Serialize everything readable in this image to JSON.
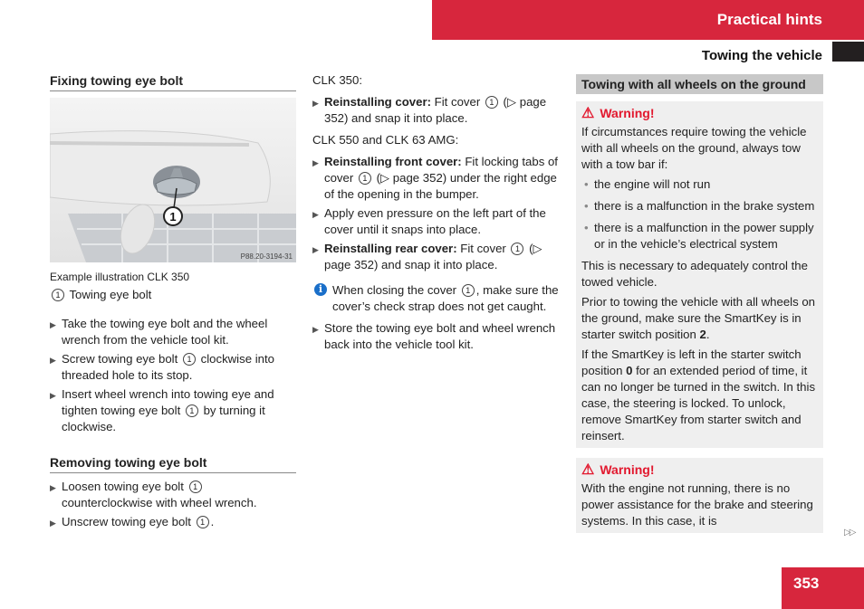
{
  "header": {
    "chapter": "Practical hints",
    "section": "Towing the vehicle",
    "accent_color": "#d7263d"
  },
  "col1": {
    "heading": "Fixing towing eye bolt",
    "figure": {
      "callout": "1",
      "code": "P88.20-3194-31",
      "caption": "Example illustration CLK 350"
    },
    "legend": {
      "num": "1",
      "label": "Towing eye bolt"
    },
    "steps": [
      {
        "pre": "Take the towing eye bolt and the wheel wrench from the vehicle tool kit.",
        "num": "",
        "post": ""
      },
      {
        "pre": "Screw towing eye bolt ",
        "num": "1",
        "post": " clockwise into threaded hole to its stop."
      },
      {
        "pre": "Insert wheel wrench into towing eye and tighten towing eye bolt ",
        "num": "1",
        "post": " by turning it clockwise."
      }
    ],
    "heading2": "Removing towing eye bolt",
    "steps2": [
      {
        "pre": "Loosen towing eye bolt ",
        "num": "1",
        "post": " counterclockwise with wheel wrench."
      },
      {
        "pre": "Unscrew towing eye bolt ",
        "num": "1",
        "post": "."
      }
    ]
  },
  "col2": {
    "model1": "CLK 350:",
    "step1": {
      "bold": "Reinstalling cover:",
      "pre": " Fit cover ",
      "num": "1",
      "post": " (▷ page 352) and snap it into place."
    },
    "model2": "CLK 550 and CLK 63 AMG:",
    "step2": {
      "bold": "Reinstalling front cover:",
      "pre": " Fit locking tabs of cover ",
      "num": "1",
      "post": " (▷ page 352) under the right edge of the opening in the bumper."
    },
    "step3": "Apply even pressure on the left part of the cover until it snaps into place.",
    "step4": {
      "bold": "Reinstalling rear cover:",
      "pre": " Fit cover ",
      "num": "1",
      "post": " (▷ page 352) and snap it into place."
    },
    "info": {
      "icon": "i",
      "pre": "When closing the cover ",
      "num": "1",
      "post": ", make sure the cover’s check strap does not get caught."
    },
    "step5": "Store the towing eye bolt and wheel wrench back into the vehicle tool kit."
  },
  "col3": {
    "title": "Towing with all wheels on the ground",
    "warning1": {
      "label": "Warning!",
      "intro": "If circumstances require towing the vehicle with all wheels on the ground, always tow with a tow bar if:",
      "bullets": [
        "the engine will not run",
        "there is a malfunction in the brake system",
        "there is a malfunction in the power supply or in the vehicle’s electrical system"
      ],
      "p1": "This is necessary to adequately control the towed vehicle.",
      "p2_pre": "Prior to towing the vehicle with all wheels on the ground, make sure the SmartKey is in starter switch position ",
      "p2_bold": "2",
      "p2_post": ".",
      "p3_pre": "If the SmartKey is left in the starter switch position ",
      "p3_bold": "0",
      "p3_post": " for an extended period of time, it can no longer be turned in the switch. In this case, the steering is locked. To unlock, remove SmartKey from starter switch and reinsert."
    },
    "warning2": {
      "label": "Warning!",
      "text": "With the engine not running, there is no power assistance for the brake and steering systems. In this case, it is"
    }
  },
  "footer": {
    "continue_icon": "▷▷",
    "page": "353"
  }
}
